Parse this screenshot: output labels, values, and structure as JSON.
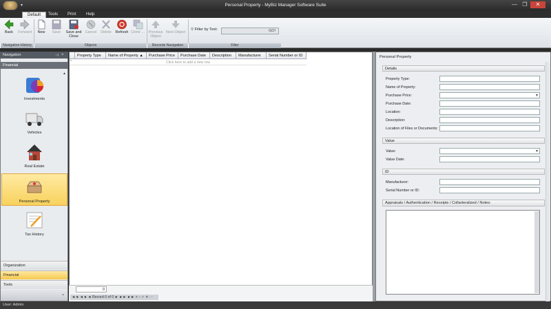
{
  "window": {
    "title": "Personal Property - MyBiz Manager Software Suite",
    "controls": [
      "—",
      "❐",
      "✕"
    ]
  },
  "qat": "▾",
  "tabs": [
    "Default",
    "Tools",
    "Print",
    "Help"
  ],
  "ribbon": {
    "groups": [
      "Navigation History",
      "Objects",
      "Records Navigation",
      "Filter"
    ],
    "buttons": {
      "back": "Back",
      "forward": "Forward",
      "new": "New",
      "save": "Save",
      "save_close": "Save and Close",
      "cancel": "Cancel",
      "delete": "Delete",
      "refresh": "Refresh",
      "clone": "Clone ...",
      "prev": "Previous Object",
      "next": "Next Object"
    },
    "filter_label": "Filter by Text:",
    "filter_go": "GO!"
  },
  "nav": {
    "header": "Navigation",
    "sub": "Financial",
    "items": [
      "Investments",
      "Vehicles",
      "Real Estate",
      "Personal Property",
      "Tax History"
    ],
    "selected": "Personal Property",
    "bars": [
      "Organization",
      "Financial",
      "Tools"
    ],
    "selected_bar": "Financial"
  },
  "grid": {
    "columns": [
      "Property Type",
      "Name of Property ▲",
      "Purchase Price",
      "Purchase Date",
      "Description",
      "Manufacturer",
      "Serial Number or ID"
    ],
    "new_row": "Click here to add a new row",
    "footer_count": "0",
    "pager": "◄◄  ◄◄  ◄  Record 0 of 0  ►  ►►  ►►  +  −  ✓  ✕  ⋯"
  },
  "detail": {
    "title": "Personal Property",
    "sections": {
      "details": "Details",
      "value": "Value",
      "id": "ID",
      "notes": "Appraisals / Authentication / Receipts / Collarteralized / Notes:"
    },
    "detail_fields": [
      "Property Type:",
      "Name of Property:",
      "Purchase Price:",
      "Purchase Date:",
      "Location:",
      "Description:",
      "Location of Files or Documents:"
    ],
    "value_fields": [
      "Value:",
      "Value Date:"
    ],
    "id_fields": [
      "Manufacturer:",
      "Serial Number or ID:"
    ]
  },
  "status": "User: Admin",
  "colors": {
    "selected": "#f8d25d",
    "chrome": "#2b2b2b",
    "ribbon": "#dfe3e8"
  }
}
